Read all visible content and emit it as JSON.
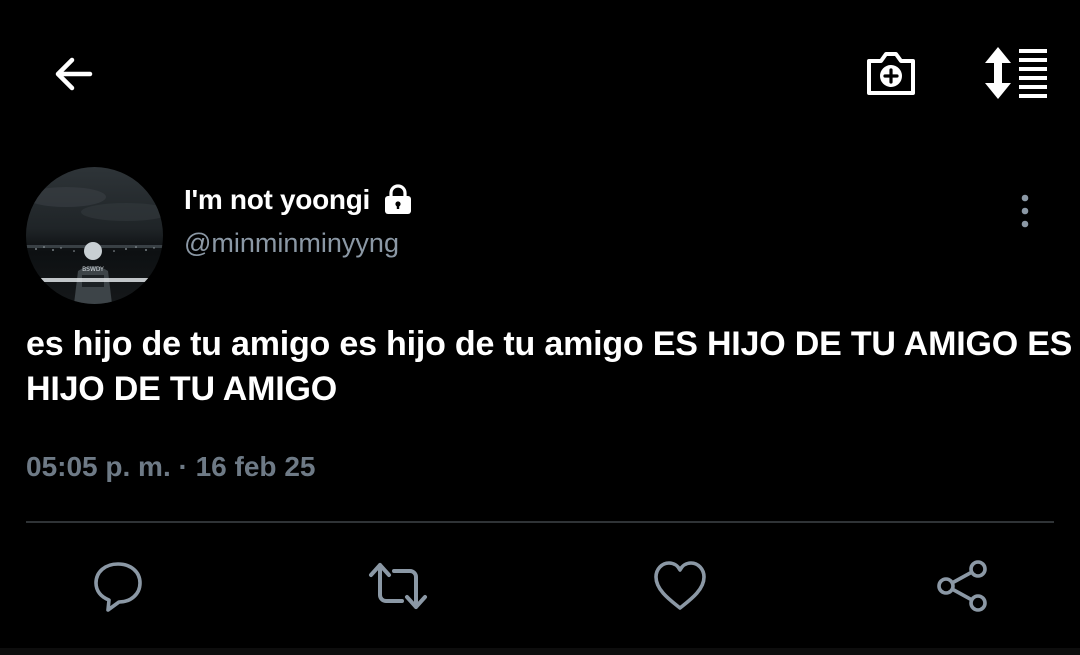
{
  "header": {
    "back_icon": "arrow-left-icon",
    "camera_icon": "camera-plus-icon",
    "sort_icon": "sort-lines-icon"
  },
  "author": {
    "display_name": "I'm not yoongi",
    "handle": "@minminminyyng",
    "protected_icon": "lock-icon"
  },
  "tweet": {
    "text": "es hijo de tu amigo es hijo de tu amigo ES HIJO DE TU AMIGO ES HIJO DE TU AMIGO",
    "timestamp": "05:05 p. m. · 16 feb 25"
  },
  "actions": {
    "reply_icon": "reply-icon",
    "retweet_icon": "retweet-icon",
    "like_icon": "heart-icon",
    "share_icon": "share-icon",
    "more_icon": "more-vertical-icon"
  },
  "colors": {
    "background": "#000000",
    "primary_text": "#ffffff",
    "secondary_text": "#8b98a5",
    "icon_gray": "#8b98a5",
    "divider": "#2f3336"
  }
}
